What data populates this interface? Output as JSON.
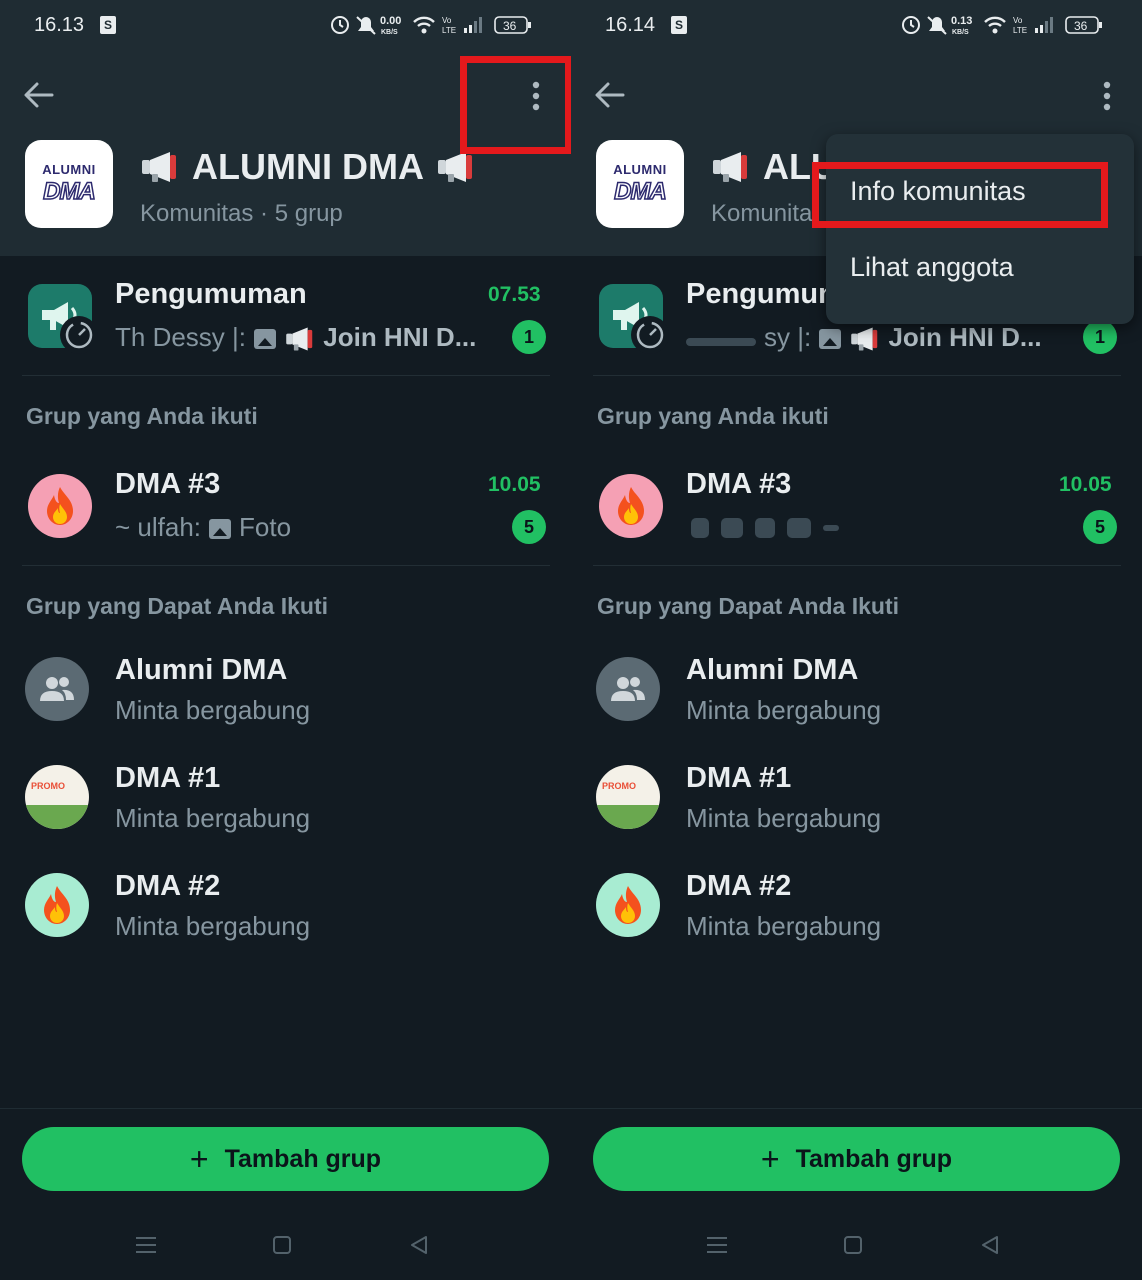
{
  "colors": {
    "accent": "#21c063",
    "highlight": "#e4191c",
    "background": "#121b22",
    "header": "#1f2c33"
  },
  "panels": [
    {
      "status": {
        "time": "16.13",
        "net_speed": "0.00",
        "net_unit": "KB/S",
        "battery": "36"
      },
      "header": {
        "logo_top": "ALUMNI",
        "logo_bottom": "DMA",
        "title": "ALUMNI DMA",
        "subtitle": "Komunitas · 5 grup"
      },
      "announcement": {
        "title": "Pengumuman",
        "time": "07.53",
        "preview_prefix": "Th Dessy |:",
        "preview_text": "Join HNI D...",
        "count": "1"
      },
      "joined_section": "Grup yang Anda ikuti",
      "joined": [
        {
          "name": "DMA #3",
          "preview_prefix": "~ ulfah:",
          "preview_text": "Foto",
          "time": "10.05",
          "count": "5"
        }
      ],
      "available_section": "Grup yang Dapat Anda Ikuti",
      "available": [
        {
          "name": "Alumni DMA",
          "status": "Minta bergabung"
        },
        {
          "name": "DMA #1",
          "status": "Minta bergabung",
          "promo": "PROMO"
        },
        {
          "name": "DMA #2",
          "status": "Minta bergabung"
        }
      ],
      "add_button": "Tambah grup"
    },
    {
      "status": {
        "time": "16.14",
        "net_speed": "0.13",
        "net_unit": "KB/S",
        "battery": "36"
      },
      "header": {
        "logo_top": "ALUMNI",
        "logo_bottom": "DMA",
        "title": "ALU",
        "subtitle": "Komunita"
      },
      "announcement": {
        "title": "Pengumun",
        "time": "",
        "preview_prefix": "sy |:",
        "preview_text": "Join HNI D...",
        "count": "1"
      },
      "joined_section": "Grup yang Anda ikuti",
      "joined": [
        {
          "name": "DMA #3",
          "time": "10.05",
          "count": "5"
        }
      ],
      "available_section": "Grup yang Dapat Anda Ikuti",
      "available": [
        {
          "name": "Alumni DMA",
          "status": "Minta bergabung"
        },
        {
          "name": "DMA #1",
          "status": "Minta bergabung",
          "promo": "PROMO"
        },
        {
          "name": "DMA #2",
          "status": "Minta bergabung"
        }
      ],
      "add_button": "Tambah grup",
      "menu": [
        "Info komunitas",
        "Lihat anggota"
      ]
    }
  ]
}
